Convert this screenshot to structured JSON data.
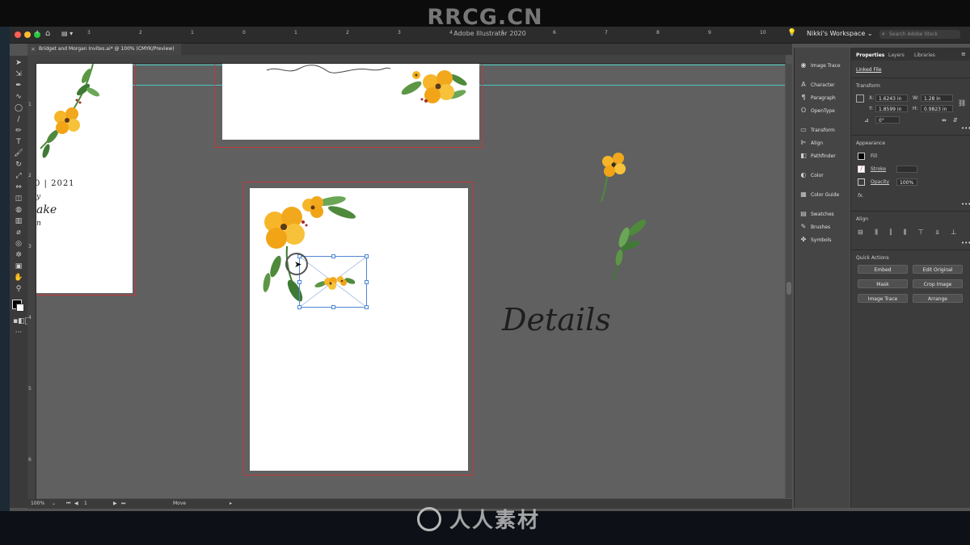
{
  "watermark_top": "RRCG.CN",
  "watermark_bottom": "人人素材",
  "app": {
    "title": "Adobe Illustrator 2020",
    "workspace": "Nikki's Workspace",
    "search_placeholder": "Search Adobe Stock",
    "document_tab": "Bridget and Morgan Invites.ai* @ 100% (CMYK/Preview)"
  },
  "rulers": {
    "top": [
      "4",
      "3",
      "2",
      "1",
      "0",
      "1",
      "2",
      "3",
      "4",
      "5",
      "6",
      "7",
      "8",
      "9",
      "10"
    ],
    "left": [
      "1",
      "2",
      "3",
      "4",
      "5",
      "6"
    ]
  },
  "canvas": {
    "card_left_text": [
      "0 | 2021",
      "y",
      "ake",
      "n"
    ],
    "details_script": "Details"
  },
  "icon_panel": [
    {
      "icon": "image-trace-icon",
      "label": "Image Trace"
    },
    {
      "icon": "character-icon",
      "label": "Character"
    },
    {
      "icon": "paragraph-icon",
      "label": "Paragraph"
    },
    {
      "icon": "opentype-icon",
      "label": "OpenType"
    },
    {
      "icon": "transform-icon",
      "label": "Transform"
    },
    {
      "icon": "align-icon",
      "label": "Align"
    },
    {
      "icon": "pathfinder-icon",
      "label": "Pathfinder"
    },
    {
      "icon": "color-icon",
      "label": "Color"
    },
    {
      "icon": "color-guide-icon",
      "label": "Color Guide"
    },
    {
      "icon": "swatches-icon",
      "label": "Swatches"
    },
    {
      "icon": "brushes-icon",
      "label": "Brushes"
    },
    {
      "icon": "symbols-icon",
      "label": "Symbols"
    }
  ],
  "properties": {
    "tabs": [
      "Properties",
      "Layers",
      "Libraries"
    ],
    "linked_file": "Linked File",
    "transform_heading": "Transform",
    "x_label": "X:",
    "x_value": "1.6243 in",
    "y_label": "Y:",
    "y_value": "1.8599 in",
    "w_label": "W:",
    "w_value": "1.28 in",
    "h_label": "H:",
    "h_value": "0.9823 in",
    "rotate_value": "0°",
    "appearance_heading": "Appearance",
    "fill_label": "Fill",
    "stroke_label": "Stroke",
    "opacity_label": "Opacity",
    "opacity_value": "100%",
    "fx_label": "fx.",
    "align_heading": "Align",
    "quick_actions_heading": "Quick Actions",
    "buttons": [
      "Embed",
      "Edit Original",
      "Mask",
      "Crop Image",
      "Image Trace",
      "Arrange"
    ]
  },
  "status": {
    "zoom": "100%",
    "artboard_no": "1",
    "mode": "Move"
  },
  "colors": {
    "accent_red": "#c0393b",
    "guide_cyan": "#46c7c0",
    "flower_yellow": "#f3b21c",
    "leaf_green": "#4f8a3c"
  }
}
